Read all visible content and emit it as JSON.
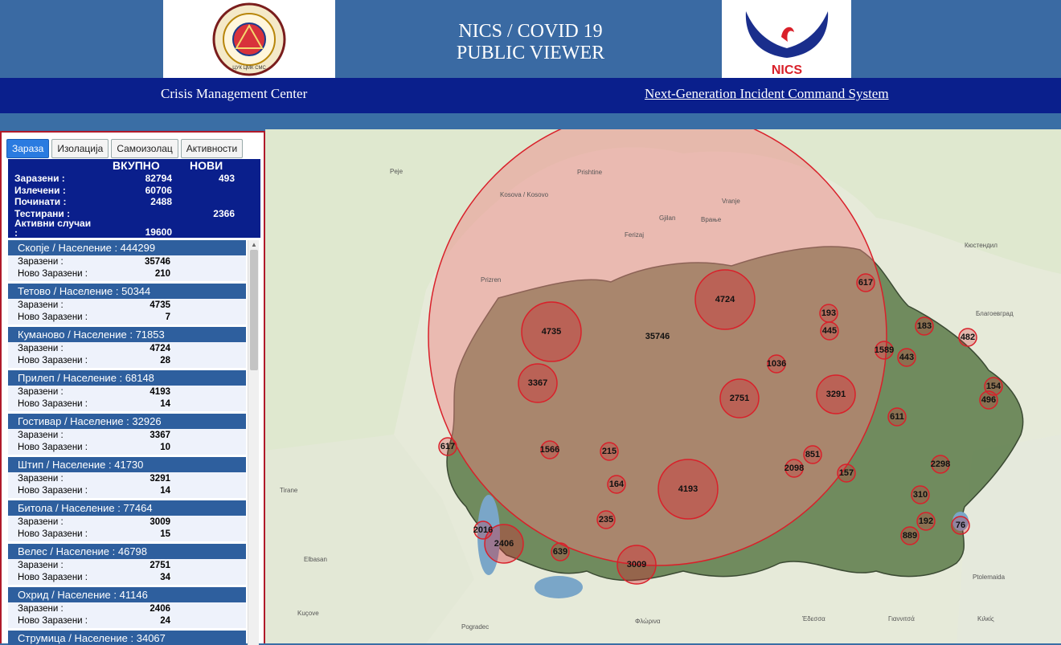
{
  "header": {
    "title_line1": "NICS / COVID 19",
    "title_line2": "PUBLIC VIEWER",
    "left_logo_text": "ЦУК ЦМК СМС",
    "right_logo_text": "NICS",
    "subtitle_left": "Crisis Management Center",
    "subtitle_right": "Next-Generation Incident Command System"
  },
  "tabs": [
    {
      "label": "Зараза",
      "active": true
    },
    {
      "label": "Изолација",
      "active": false
    },
    {
      "label": "Самоизолац",
      "active": false
    },
    {
      "label": "Активности",
      "active": false
    }
  ],
  "summary": {
    "col_total": "ВКУПНО",
    "col_new": "НОВИ",
    "infected_label": "Заразени :",
    "infected_total": "82794",
    "infected_new": "493",
    "recovered_label": "Излечени :",
    "recovered_total": "60706",
    "deceased_label": "Починати :",
    "deceased_total": "2488",
    "tested_label": "Тестирани :",
    "tested_new": "2366",
    "active_label_1": "Активни случаи",
    "active_label_2": ":",
    "active_total": "19600"
  },
  "labels": {
    "infected": "Заразени :",
    "new_infected": "Ново Заразени :"
  },
  "cities": [
    {
      "header": "Скопје / Население : 444299",
      "infected": "35746",
      "new": "210"
    },
    {
      "header": "Тетово / Население : 50344",
      "infected": "4735",
      "new": "7"
    },
    {
      "header": "Куманово / Население : 71853",
      "infected": "4724",
      "new": "28"
    },
    {
      "header": "Прилеп / Население : 68148",
      "infected": "4193",
      "new": "14"
    },
    {
      "header": "Гостивар / Население : 32926",
      "infected": "3367",
      "new": "10"
    },
    {
      "header": "Штип / Население : 41730",
      "infected": "3291",
      "new": "14"
    },
    {
      "header": "Битола / Население : 77464",
      "infected": "3009",
      "new": "15"
    },
    {
      "header": "Велес / Население : 46798",
      "infected": "2751",
      "new": "34"
    },
    {
      "header": "Охрид / Население : 41146",
      "infected": "2406",
      "new": "24"
    },
    {
      "header": "Струмица / Население : 34067",
      "infected": "",
      "new": ""
    }
  ],
  "map": {
    "big_circle_color": "#f08080",
    "marker_color": "#d9202a",
    "big_label": "35746",
    "place_names": [
      "Prishtine",
      "Kosova / Kosovo",
      "Prizren",
      "Peje",
      "Gjilan",
      "Ferizaj",
      "Tirane",
      "Pogradec",
      "Kuçove",
      "Elbasan",
      "Vranje",
      "Врање",
      "Кюстендил",
      "Благоевград",
      "Κιλκίς",
      "Φλώρινα",
      "Έδεσσα",
      "Γιαννιτσά",
      "Ptolemaida"
    ],
    "markers": [
      {
        "label": "4724",
        "size": "large"
      },
      {
        "label": "4735",
        "size": "large"
      },
      {
        "label": "4193",
        "size": "large"
      },
      {
        "label": "3367",
        "size": "medium"
      },
      {
        "label": "3291",
        "size": "medium"
      },
      {
        "label": "3009",
        "size": "medium"
      },
      {
        "label": "2751",
        "size": "medium"
      },
      {
        "label": "2406",
        "size": "medium"
      },
      {
        "label": "2298",
        "size": "small"
      },
      {
        "label": "2098",
        "size": "small"
      },
      {
        "label": "2016",
        "size": "small"
      },
      {
        "label": "1589",
        "size": "small"
      },
      {
        "label": "1566",
        "size": "small"
      },
      {
        "label": "1036",
        "size": "small"
      },
      {
        "label": "889",
        "size": "small"
      },
      {
        "label": "851",
        "size": "small"
      },
      {
        "label": "639",
        "size": "small"
      },
      {
        "label": "617",
        "size": "small"
      },
      {
        "label": "617",
        "size": "small"
      },
      {
        "label": "611",
        "size": "small"
      },
      {
        "label": "496",
        "size": "small"
      },
      {
        "label": "482",
        "size": "small"
      },
      {
        "label": "445",
        "size": "small"
      },
      {
        "label": "443",
        "size": "small"
      },
      {
        "label": "310",
        "size": "small"
      },
      {
        "label": "235",
        "size": "small"
      },
      {
        "label": "215",
        "size": "small"
      },
      {
        "label": "193",
        "size": "small"
      },
      {
        "label": "192",
        "size": "small"
      },
      {
        "label": "183",
        "size": "small"
      },
      {
        "label": "164",
        "size": "small"
      },
      {
        "label": "157",
        "size": "small"
      },
      {
        "label": "154",
        "size": "small"
      },
      {
        "label": "76",
        "size": "small"
      }
    ]
  }
}
